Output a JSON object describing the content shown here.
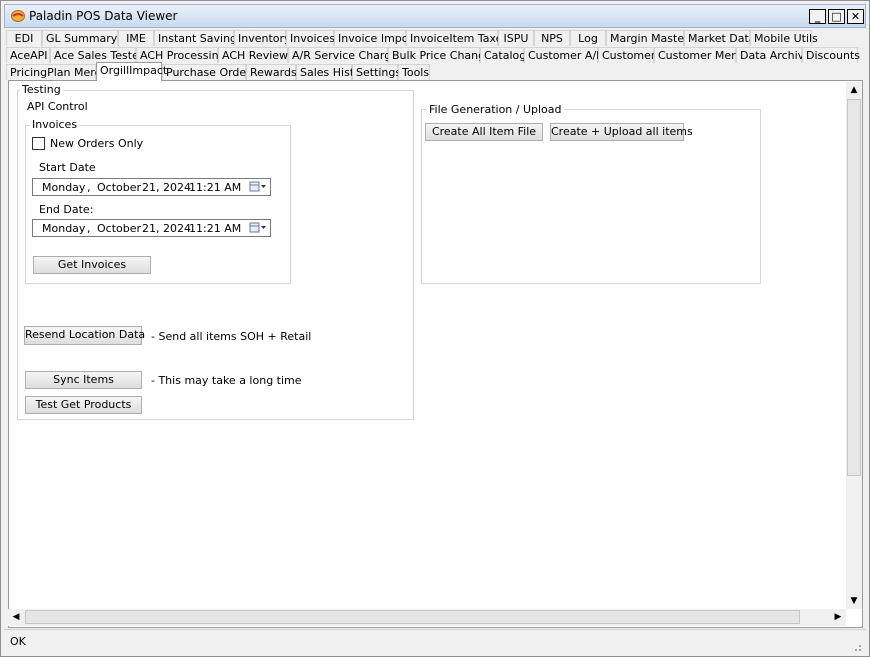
{
  "window": {
    "title": "Paladin POS Data Viewer",
    "minimize": "_",
    "maximize": "□",
    "close": "✕"
  },
  "tabs": {
    "row1": [
      "EDI",
      "GL Summary",
      "IME",
      "Instant Savings",
      "Inventory",
      "Invoices",
      "Invoice Import",
      "InvoiceItem Taxes",
      "ISPU",
      "NPS",
      "Log",
      "Margin Master",
      "Market Data",
      "Mobile Utils"
    ],
    "row2": [
      "AceAPI",
      "Ace Sales Tester",
      "ACH Processing",
      "ACH Review",
      "A/R Service Charge",
      "Bulk Price Change",
      "Catalog",
      "Customer A/R",
      "Customers",
      "Customer Merge",
      "Data Archive",
      "Discounts"
    ],
    "row3": [
      "PricingPlan Merge",
      "OrgillImpact",
      "Purchase Orders",
      "Rewards",
      "Sales Hist",
      "Settings",
      "Tools"
    ],
    "active": "OrgillImpact"
  },
  "testing": {
    "group_label": "Testing",
    "api_control": {
      "group_label": "API Control",
      "invoices": {
        "group_label": "Invoices",
        "new_orders_only_label": "New Orders Only",
        "new_orders_only_checked": false,
        "start_date_label": "Start Date",
        "start_date": {
          "weekday": "Monday",
          "sep": ",",
          "month": "October",
          "day_year": "21, 2024",
          "time": "11:21 AM"
        },
        "end_date_label": "End Date:",
        "end_date": {
          "weekday": "Monday",
          "sep": ",",
          "month": "October",
          "day_year": "21, 2024",
          "time": "11:21 AM"
        },
        "get_invoices_button": "Get Invoices"
      },
      "resend_location_button": "Resend Location Data",
      "resend_location_note": "- Send all items SOH + Retail",
      "sync_items_button": "Sync Items",
      "sync_items_note": "- This may take a long time",
      "test_get_products_button": "Test Get  Products"
    },
    "file_generation": {
      "group_label": "File Generation / Upload",
      "create_all_button": "Create All Item File",
      "create_upload_button": "Create + Upload all items"
    }
  },
  "status": {
    "text": "OK"
  },
  "colors": {
    "titlebar": "#c8d9ee",
    "page_bg": "#ffffff",
    "chrome_bg": "#f0f0f0"
  }
}
